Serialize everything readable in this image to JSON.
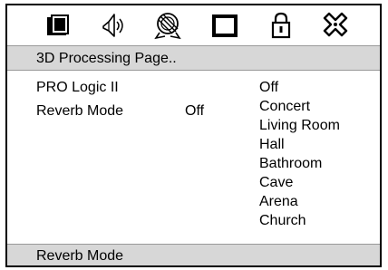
{
  "icon_bar": {
    "icons": [
      "display-icon",
      "speaker-icon",
      "disc-icon",
      "video-screen-icon",
      "lock-icon",
      "setup-icon"
    ]
  },
  "header": {
    "title": "3D Processing Page.."
  },
  "settings": [
    {
      "label": "PRO Logic II",
      "value": ""
    },
    {
      "label": "Reverb Mode",
      "value": "Off"
    }
  ],
  "options": [
    "Off",
    "Concert",
    "Living Room",
    "Hall",
    "Bathroom",
    "Cave",
    "Arena",
    "Church"
  ],
  "footer": {
    "text": "Reverb Mode"
  },
  "colors": {
    "bar_background": "#d7d7d7",
    "border": "#000000"
  }
}
